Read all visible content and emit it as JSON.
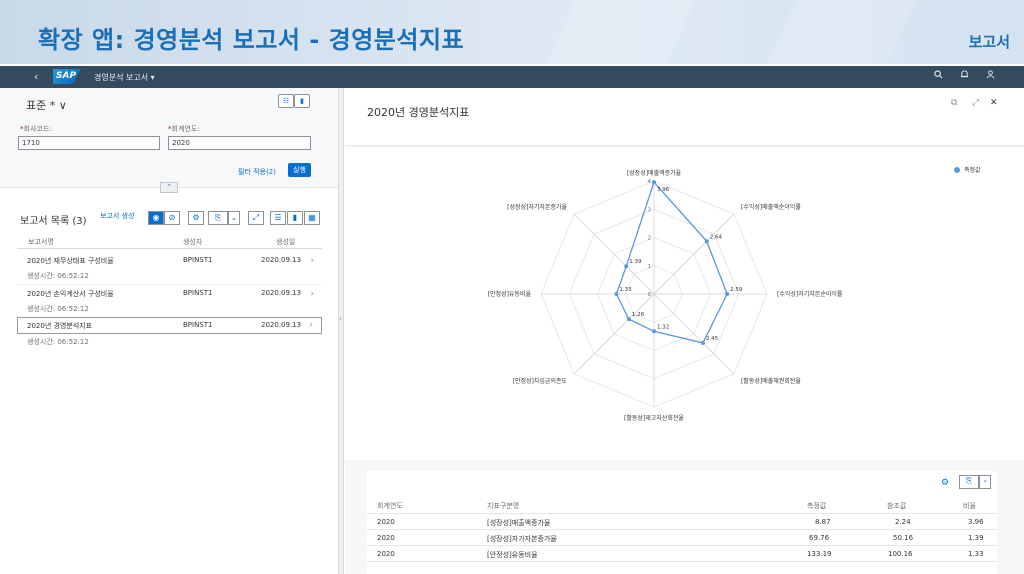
{
  "banner": {
    "title": "확장 앱: 경영분석 보고서 - 경영분석지표",
    "doc_type": "보고서"
  },
  "shell": {
    "back_glyph": "‹",
    "logo": "SAP",
    "app_name": "경영분석 보고서 ▾",
    "icons": [
      "search-icon",
      "bell-icon",
      "user-icon"
    ]
  },
  "filter": {
    "variant": "표준 * ∨",
    "company_label": "회사코드:",
    "company_value": "1710",
    "year_label": "회계연도:",
    "year_value": "2020",
    "filter_link": "필터 적용(2)",
    "go_label": "실행",
    "collapse_glyph": "⌃"
  },
  "list": {
    "title": "보고서 목록 (3)",
    "create_link": "보고서 생성",
    "columns": [
      "보고서명",
      "생성자",
      "생성일"
    ],
    "rows": [
      {
        "name": "2020년 재무상태표 구성비율",
        "creator": "BPINST1",
        "date": "2020.09.13",
        "time": "생성시간: 06:52:12"
      },
      {
        "name": "2020년 손익계산서 구성비율",
        "creator": "BPINST1",
        "date": "2020.09.13",
        "time": "생성시간: 06:52:12"
      },
      {
        "name": "2020년 경영분석지표",
        "creator": "BPINST1",
        "date": "2020.09.13",
        "time": "생성시간: 06:52:12"
      }
    ]
  },
  "detail": {
    "title": "2020년 경영분석지표",
    "close_glyph": "✕"
  },
  "chart_data": {
    "type": "radar",
    "legend": "측정값",
    "legend_position": "top-right",
    "axes": [
      "[성장성]매출액증가율",
      "[수익성]매출액순이익률",
      "[수익성]자기자본순이익률",
      "[활동성]매출채권회전율",
      "[활동성]재고자산회전율",
      "[안정성]차입금의존도",
      "[안정성]유동비율",
      "[성장성]자기자본증가율"
    ],
    "values": [
      3.96,
      2.64,
      2.59,
      2.45,
      1.32,
      1.26,
      1.33,
      1.39
    ],
    "ticks": [
      "0",
      "1",
      "2",
      "3",
      "4"
    ],
    "range": [
      0,
      4
    ],
    "color": "#5899da"
  },
  "table": {
    "columns": [
      "회계연도",
      "지표구분명",
      "측정값",
      "참조값",
      "비율"
    ],
    "rows": [
      [
        "2020",
        "[성장성]매출액증가율",
        "8.87",
        "2.24",
        "3.96"
      ],
      [
        "2020",
        "[성장성]자가자본증가율",
        "69.76",
        "50.16",
        "1.39"
      ],
      [
        "2020",
        "[안정성]유동비율",
        "133.19",
        "100.16",
        "1.33"
      ]
    ]
  }
}
